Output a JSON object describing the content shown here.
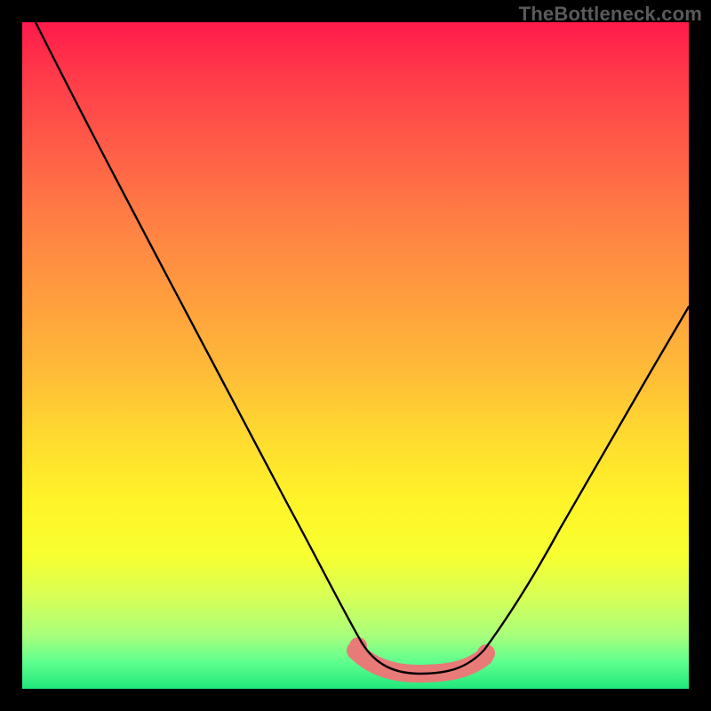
{
  "watermark": "TheBottleneck.com",
  "colors": {
    "background": "#000000",
    "curve_stroke": "#000000",
    "salmon_band": "#e87a78",
    "gradient_top": "#ff1a4b",
    "gradient_bottom": "#22e87c"
  },
  "chart_data": {
    "type": "line",
    "title": "",
    "xlabel": "",
    "ylabel": "",
    "xlim": [
      0,
      100
    ],
    "ylim": [
      0,
      100
    ],
    "series": [
      {
        "name": "bottleneck-curve",
        "x": [
          2,
          5,
          10,
          15,
          20,
          25,
          30,
          35,
          40,
          45,
          50,
          52,
          55,
          58,
          60,
          63,
          65,
          68,
          70,
          75,
          80,
          85,
          90,
          95,
          100
        ],
        "y": [
          100,
          95,
          86,
          77,
          68,
          59,
          50,
          41,
          32,
          23,
          14,
          10,
          6,
          4,
          3,
          3,
          3,
          4,
          6,
          12,
          20,
          29,
          38,
          47,
          56
        ]
      }
    ],
    "highlight_band": {
      "name": "optimal-range",
      "x_from": 50,
      "x_to": 70,
      "y_approx": 3,
      "color": "#e87a78"
    },
    "notes": "Values estimated from pixel positions; y = 0 is bottom (green), y = 100 is top (red)."
  }
}
